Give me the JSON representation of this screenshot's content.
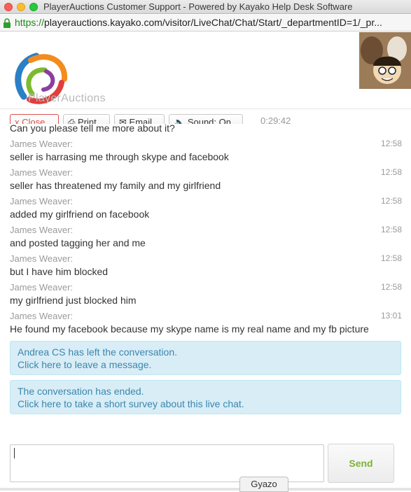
{
  "window": {
    "title": "PlayerAuctions Customer Support - Powered by Kayako Help Desk Software"
  },
  "browser": {
    "url_protocol": "https://",
    "url_rest": "playerauctions.kayako.com/visitor/LiveChat/Chat/Start/_departmentID=1/_pr..."
  },
  "brand": {
    "name": "PlayerAuctions"
  },
  "toolbar": {
    "close_label": "x Close",
    "print_label": "Print",
    "email_label": "Email",
    "sound_label": "Sound: On",
    "timer": "0:29:42"
  },
  "chat": {
    "partial_line": "Can you please tell me more about it?",
    "messages": [
      {
        "sender": "James Weaver:",
        "time": "12:58",
        "text": "seller is harrasing me through skype and facebook"
      },
      {
        "sender": "James Weaver:",
        "time": "12:58",
        "text": "seller has threatened my family and my girlfriend"
      },
      {
        "sender": "James Weaver:",
        "time": "12:58",
        "text": "added my girlfriend on facebook"
      },
      {
        "sender": "James Weaver:",
        "time": "12:58",
        "text": "and posted tagging her and me"
      },
      {
        "sender": "James Weaver:",
        "time": "12:58",
        "text": "but I have him blocked"
      },
      {
        "sender": "James Weaver:",
        "time": "12:58",
        "text": "my girlfriend just blocked him"
      },
      {
        "sender": "James Weaver:",
        "time": "13:01",
        "text": "He found my facebook because my skype name is my real name and my fb picture"
      }
    ],
    "notices": [
      {
        "line1": "Andrea CS has left the conversation.",
        "line2": "Click here to leave a message."
      },
      {
        "line1": "The conversation has ended.",
        "line2": "Click here to take a short survey about this live chat."
      }
    ]
  },
  "composer": {
    "send_label": "Send",
    "input_value": ""
  },
  "overlay": {
    "gyazo_label": "Gyazo"
  }
}
